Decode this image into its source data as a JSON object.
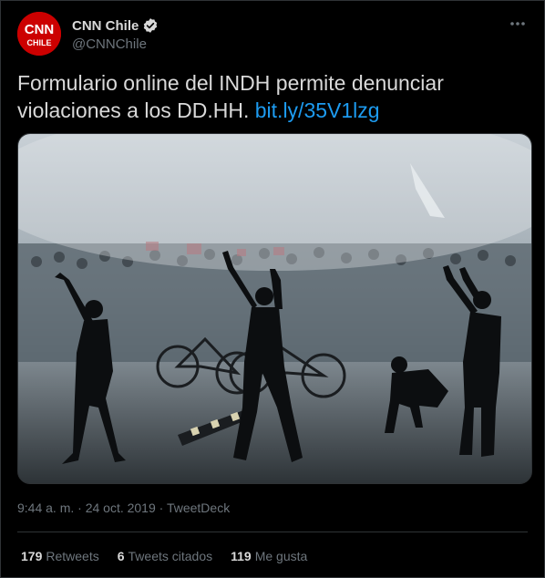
{
  "account": {
    "display_name": "CNN Chile",
    "handle": "@CNNChile",
    "avatar_text_top": "CNN",
    "avatar_text_bottom": "CHILE",
    "avatar_color": "#cc0000",
    "verified": true
  },
  "tweet": {
    "text": "Formulario online del INDH permite denunciar violaciones a los DD.HH. ",
    "link": "bit.ly/35V1lzg",
    "link_color": "#1d9bf0"
  },
  "media": {
    "description_icon": "photo-protest-water-cannon"
  },
  "meta": {
    "time": "9:44 a. m. · 24 oct. 2019 · TweetDeck"
  },
  "stats": {
    "retweets_count": "179",
    "retweets_label": "Retweets",
    "quotes_count": "6",
    "quotes_label": "Tweets citados",
    "likes_count": "119",
    "likes_label": "Me gusta"
  }
}
